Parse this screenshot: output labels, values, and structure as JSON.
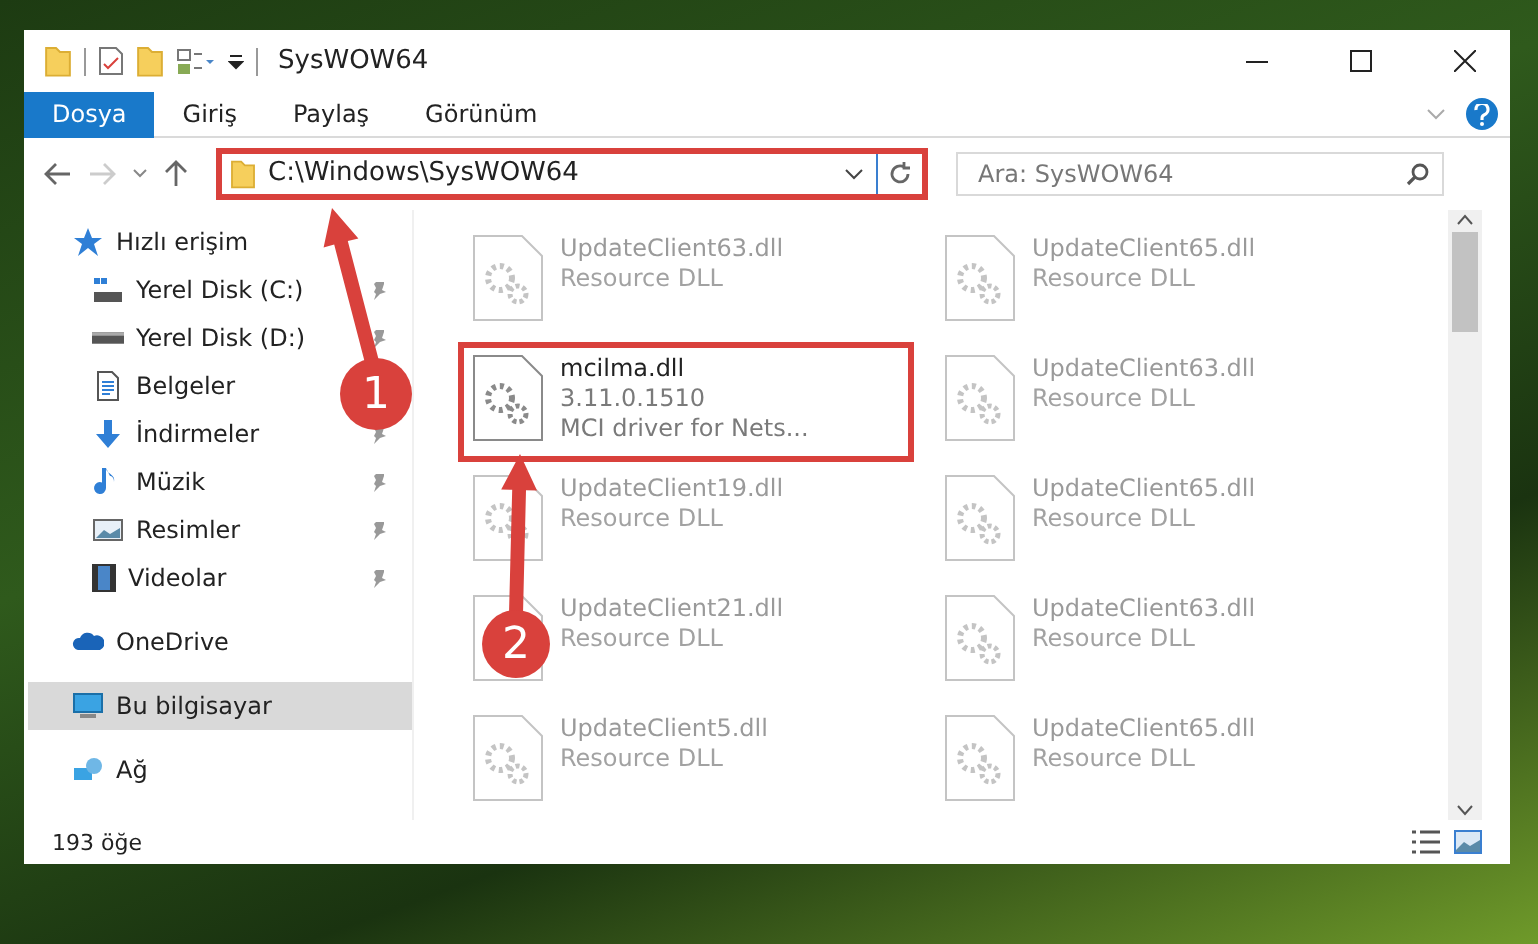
{
  "window": {
    "title": "SysWOW64"
  },
  "ribbon_tabs": [
    {
      "label": "Dosya",
      "kind": "file",
      "selected": false
    },
    {
      "label": "Giriş",
      "kind": "tab",
      "selected": false
    },
    {
      "label": "Paylaş",
      "kind": "tab",
      "selected": false
    },
    {
      "label": "Görünüm",
      "kind": "tab",
      "selected": false
    }
  ],
  "address": {
    "path": "C:\\Windows\\SysWOW64",
    "highlighted": true
  },
  "search": {
    "placeholder": "Ara: SysWOW64"
  },
  "sidebar": {
    "items": [
      {
        "label": "Hızlı erişim",
        "kind": "star",
        "selected": false,
        "children": [
          {
            "label": "Yerel Disk (C:)",
            "kind": "system-drive",
            "pinned": true,
            "selected": false
          },
          {
            "label": "Yerel Disk (D:)",
            "kind": "drive",
            "pinned": true,
            "selected": false
          },
          {
            "label": "Belgeler",
            "kind": "documents",
            "selected": false
          },
          {
            "label": "İndirmeler",
            "kind": "downloads",
            "pinned": true,
            "selected": false
          },
          {
            "label": "Müzik",
            "kind": "music",
            "pinned": true,
            "selected": false
          },
          {
            "label": "Resimler",
            "kind": "pictures",
            "pinned": true,
            "selected": false
          },
          {
            "label": "Videolar",
            "kind": "videos",
            "pinned": true,
            "selected": false
          }
        ]
      },
      {
        "label": "OneDrive",
        "kind": "cloud",
        "selected": false
      },
      {
        "label": "Bu bilgisayar",
        "kind": "computer",
        "selected": true
      },
      {
        "label": "Ağ",
        "kind": "network",
        "selected": false
      }
    ]
  },
  "files": [
    {
      "name": "UpdateClient63.dll",
      "details": [
        "Resource DLL"
      ],
      "faded": true,
      "highlighted": false
    },
    {
      "name": "UpdateClient65.dll",
      "details": [
        "Resource DLL"
      ],
      "faded": true,
      "highlighted": false
    },
    {
      "name": "mcilma.dll",
      "details": [
        "3.11.0.1510",
        "MCI driver for Nets..."
      ],
      "faded": false,
      "highlighted": true
    },
    {
      "name": "UpdateClient63.dll",
      "details": [
        "Resource DLL"
      ],
      "faded": true,
      "highlighted": false
    },
    {
      "name": "UpdateClient19.dll",
      "details": [
        "Resource DLL"
      ],
      "faded": true,
      "highlighted": false
    },
    {
      "name": "UpdateClient65.dll",
      "details": [
        "Resource DLL"
      ],
      "faded": true,
      "highlighted": false
    },
    {
      "name": "UpdateClient21.dll",
      "details": [
        "Resource DLL"
      ],
      "faded": true,
      "highlighted": false
    },
    {
      "name": "UpdateClient63.dll",
      "details": [
        "Resource DLL"
      ],
      "faded": true,
      "highlighted": false
    },
    {
      "name": "UpdateClient5.dll",
      "details": [
        "Resource DLL"
      ],
      "faded": true,
      "highlighted": false
    },
    {
      "name": "UpdateClient65.dll",
      "details": [
        "Resource DLL"
      ],
      "faded": true,
      "highlighted": false
    }
  ],
  "status_bar": {
    "count": "193 öğe"
  },
  "annotations": [
    {
      "number": "1"
    },
    {
      "number": "2"
    }
  ]
}
